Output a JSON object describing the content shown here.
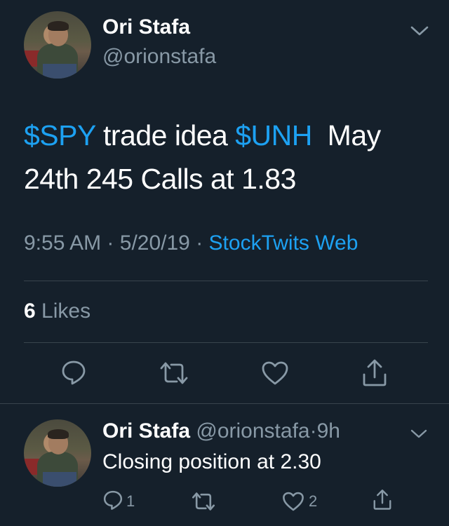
{
  "tweet": {
    "author_name": "Ori Stafa",
    "author_handle": "@orionstafa",
    "text_parts": [
      {
        "text": "$SPY",
        "kind": "cashtag"
      },
      {
        "text": " trade idea ",
        "kind": "text"
      },
      {
        "text": "$UNH",
        "kind": "cashtag"
      },
      {
        "text": "  May 24th 245 Calls at 1.83",
        "kind": "text"
      }
    ],
    "time": "9:55 AM",
    "sep1": "·",
    "date": "5/20/19",
    "sep2": "·",
    "source": "StockTwits Web",
    "likes_count": "6",
    "likes_label": "Likes"
  },
  "reply": {
    "author_name": "Ori Stafa",
    "author_handle": "@orionstafa",
    "sep": "·",
    "age": "9h",
    "text": "Closing position at 2.30",
    "reply_count": "1",
    "like_count": "2"
  },
  "colors": {
    "background": "#15202b",
    "accent": "#1da1f2",
    "muted": "#8899a6",
    "divider": "#38444d"
  },
  "icons": [
    "chevron-down-icon",
    "reply-icon",
    "retweet-icon",
    "like-icon",
    "share-icon"
  ]
}
